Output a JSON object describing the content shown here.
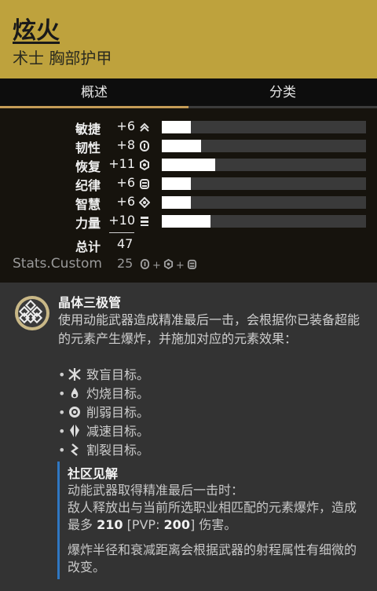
{
  "header": {
    "title": "炫火",
    "subtitle": "术士 胸部护甲",
    "bg_color": "#bea23d"
  },
  "tabs": [
    {
      "label": "概述",
      "active": true
    },
    {
      "label": "分类",
      "active": false
    }
  ],
  "stats": [
    {
      "name": "敏捷",
      "value": "+6",
      "amount": 6,
      "icon": "mobility-icon"
    },
    {
      "name": "韧性",
      "value": "+8",
      "amount": 8,
      "icon": "resilience-icon"
    },
    {
      "name": "恢复",
      "value": "+11",
      "amount": 11,
      "icon": "recovery-icon"
    },
    {
      "name": "纪律",
      "value": "+6",
      "amount": 6,
      "icon": "discipline-icon"
    },
    {
      "name": "智慧",
      "value": "+6",
      "amount": 6,
      "icon": "intellect-icon"
    },
    {
      "name": "力量",
      "value": "+10",
      "amount": 10,
      "icon": "strength-icon"
    }
  ],
  "stat_bar_max": 42,
  "total": {
    "label": "总计",
    "value": "47"
  },
  "custom": {
    "label": "Stats.Custom",
    "value": "25",
    "icons": [
      "resilience-icon",
      "recovery-icon",
      "discipline-icon"
    ],
    "plus": "+"
  },
  "perk": {
    "title": "晶体三极管",
    "description": "使用动能武器造成精准最后一击，会根据你已装备超能的元素产生爆炸，并施加对应的元素效果：",
    "bullets": [
      {
        "dot": "•",
        "icon": "blind-icon",
        "text": "致盲目标。"
      },
      {
        "dot": "•",
        "icon": "scorch-icon",
        "text": "灼烧目标。"
      },
      {
        "dot": "•",
        "icon": "weaken-icon",
        "text": "削弱目标。"
      },
      {
        "dot": "•",
        "icon": "slow-icon",
        "text": "减速目标。"
      },
      {
        "dot": "•",
        "icon": "sever-icon",
        "text": "割裂目标。"
      }
    ]
  },
  "community": {
    "title": "社区见解",
    "line1": "动能武器取得精准最后一击时：",
    "line2a": "敌人释放出与当前所选职业相匹配的元素爆炸，造成最多 ",
    "dmg": "210",
    "pvp_open": " [PVP: ",
    "pvp": "200",
    "line2b": "] 伤害。",
    "note": "爆炸半径和衰减距离会根据武器的射程属性有细微的改变。",
    "accent": "#2f77c2"
  }
}
